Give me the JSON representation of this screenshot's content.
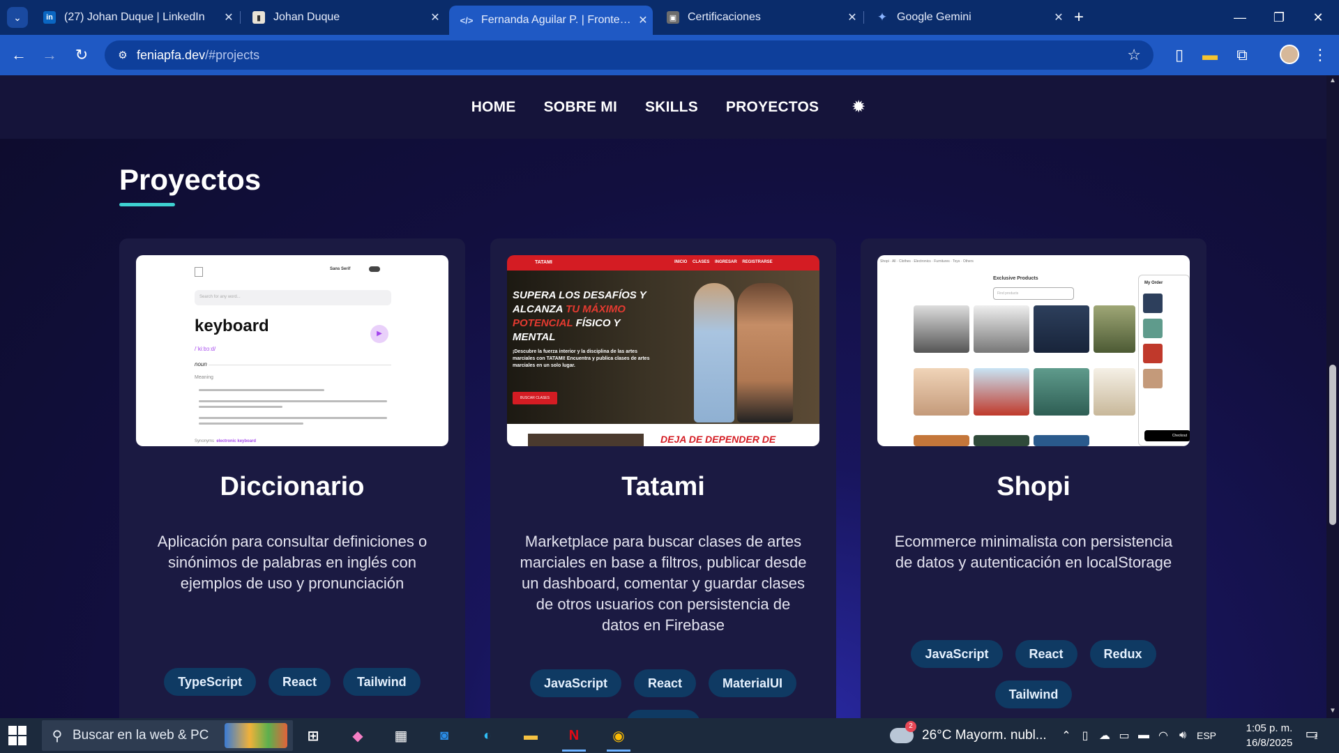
{
  "browser": {
    "tabs": [
      {
        "title": "(27) Johan Duque | LinkedIn",
        "icon": "linkedin-icon"
      },
      {
        "title": "Johan Duque",
        "icon": "page-icon"
      },
      {
        "title": "Fernanda Aguilar P. | Frontend Developer",
        "icon": "code-icon",
        "active": true
      },
      {
        "title": "Certificaciones",
        "icon": "page-icon"
      },
      {
        "title": "Google Gemini",
        "icon": "gemini-icon"
      }
    ],
    "new_tab": "+",
    "url_host": "feniapfa.dev",
    "url_path": "/#projects"
  },
  "site": {
    "nav": [
      "HOME",
      "SOBRE MI",
      "SKILLS",
      "PROYECTOS"
    ],
    "section_title": "Proyectos",
    "accent": "#3ed1d1",
    "projects": [
      {
        "title": "Diccionario",
        "description": "Aplicación para consultar definiciones o sinónimos de palabras en inglés con ejemplos de uso y pronunciación",
        "tags": [
          "TypeScript",
          "React",
          "Tailwind"
        ],
        "thumb": {
          "font": "Sans Serif",
          "search": "Search for any word...",
          "word": "keyboard",
          "phonetic": "/ˈkiːbɔːd/",
          "pos": "noun",
          "meaning": "Meaning",
          "synonyms_label": "Synonyms",
          "synonym": "electronic keyboard"
        }
      },
      {
        "title": "Tatami",
        "description": "Marketplace para buscar clases de artes marciales en base a filtros, publicar desde un dashboard, comentar y guardar clases de otros usuarios con persistencia de datos en Firebase",
        "tags": [
          "JavaScript",
          "React",
          "MaterialUI",
          ""
        ],
        "thumb": {
          "brand": "TATAMI",
          "nav": "INICIO CLASES INGRESAR REGISTRARSE",
          "headline_a": "SUPERA LOS DESAFÍOS Y ALCANZA",
          "headline_b": "TU MÁXIMO POTENCIAL",
          "headline_c": "FÍSICO Y MENTAL",
          "sub": "¡Descubre la fuerza interior y la disciplina de las artes marciales con TATAMI! Encuentra y publica clases de artes marciales en un solo lugar.",
          "cta": "BUSCAR CLASES",
          "footer": "DEJA DE DEPENDER DE"
        }
      },
      {
        "title": "Shopi",
        "description": "Ecommerce minimalista con persistencia de datos y autenticación en localStorage",
        "tags": [
          "JavaScript",
          "React",
          "Redux",
          "Tailwind"
        ],
        "thumb": {
          "heading": "Exclusive Products",
          "search": "Find products",
          "order": "My Order",
          "checkout": "Checkout"
        }
      }
    ]
  },
  "taskbar": {
    "search_placeholder": "Buscar en la web & PC",
    "weather": "26°C  Mayorm. nubl...",
    "weather_badge": "2",
    "lang": "ESP",
    "time": "1:05 p. m.",
    "date": "16/8/2025",
    "notification_count": "1"
  }
}
